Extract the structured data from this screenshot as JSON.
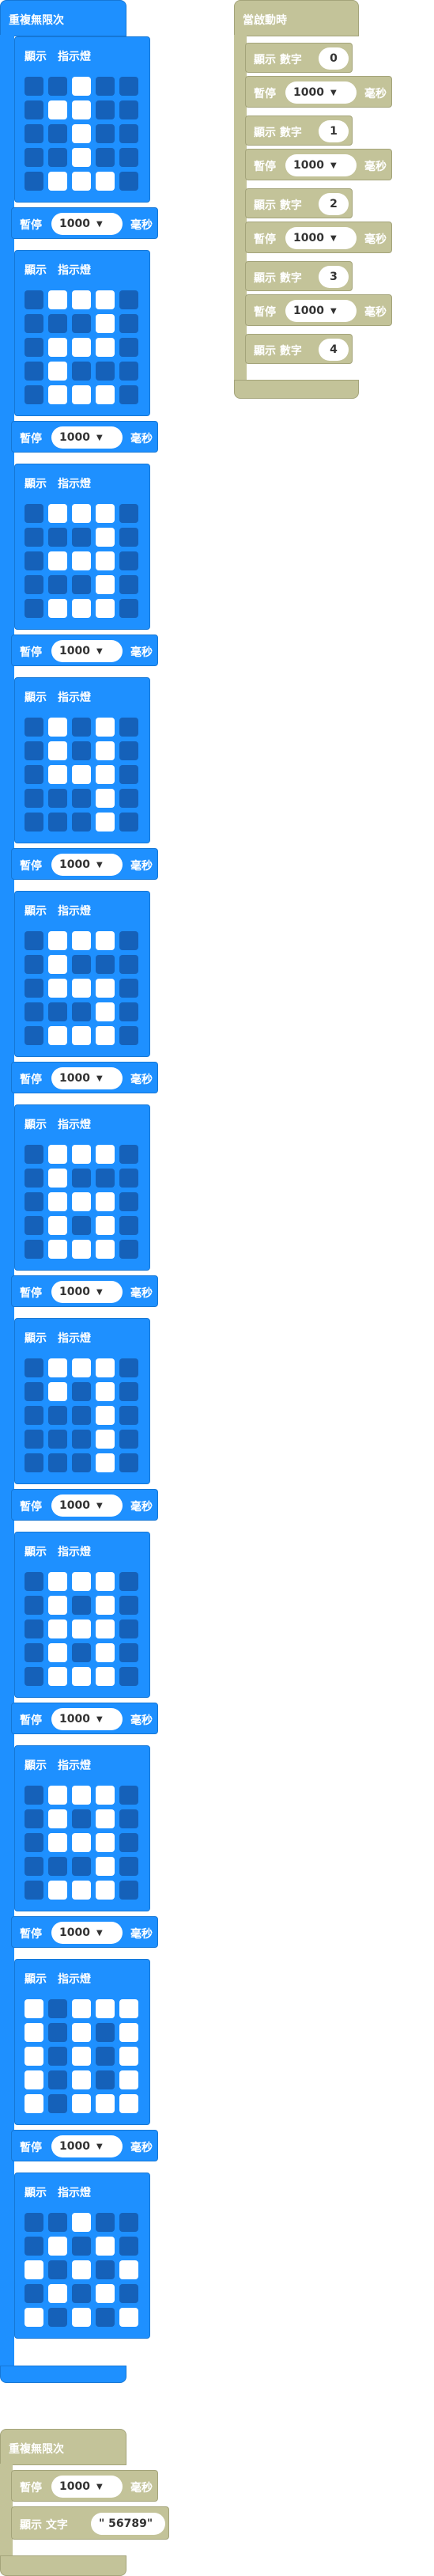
{
  "workspace": {
    "forever_block": {
      "label": "重複無限次",
      "pause_label": "暫停",
      "pause_value": "1000",
      "ms_label": "毫秒",
      "show_label": "顯示",
      "leds_label": "指示燈",
      "frames": [
        [
          "00100",
          "01100",
          "00100",
          "00100",
          "01110"
        ],
        [
          "01110",
          "00010",
          "01110",
          "01000",
          "01110"
        ],
        [
          "01110",
          "00010",
          "01110",
          "00010",
          "01110"
        ],
        [
          "01010",
          "01010",
          "01110",
          "00010",
          "00010"
        ],
        [
          "01110",
          "01000",
          "01110",
          "00010",
          "01110"
        ],
        [
          "01110",
          "01000",
          "01110",
          "01010",
          "01110"
        ],
        [
          "01110",
          "01010",
          "00010",
          "00010",
          "00010"
        ],
        [
          "01110",
          "01010",
          "01110",
          "01010",
          "01110"
        ],
        [
          "01110",
          "01010",
          "01110",
          "00010",
          "01110"
        ],
        [
          "10111",
          "10101",
          "10101",
          "10101",
          "10111"
        ],
        [
          "00100",
          "01010",
          "10101",
          "01010",
          "10101"
        ]
      ]
    },
    "on_start_block": {
      "label": "當啟動時",
      "show_number_label": "顯示 數字",
      "pause_label": "暫停",
      "pause_value": "1000",
      "ms_label": "毫秒",
      "numbers": [
        "0",
        "1",
        "2",
        "3",
        "4"
      ]
    },
    "forever_block_2": {
      "label": "重複無限次",
      "pause_label": "暫停",
      "pause_value": "1000",
      "ms_label": "毫秒",
      "show_string_label": "顯示 文字",
      "string_value": "\" 56789\""
    }
  }
}
